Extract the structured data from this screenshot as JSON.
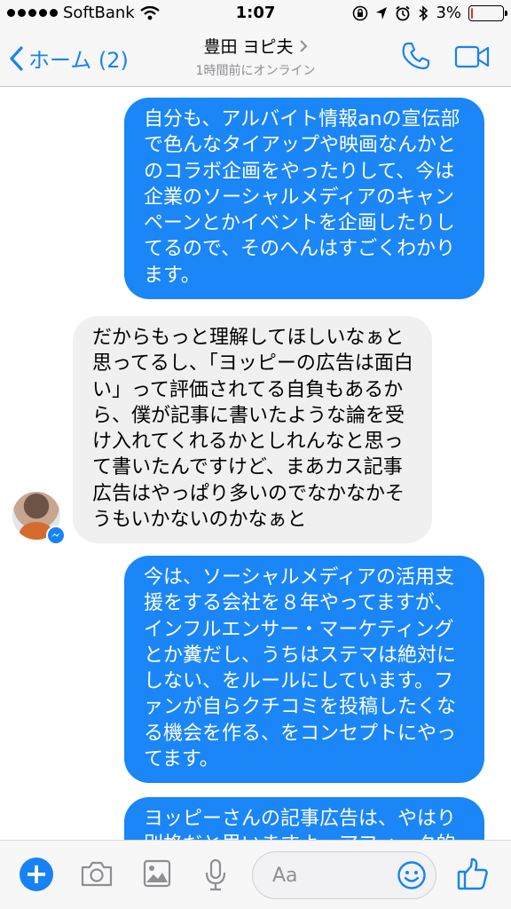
{
  "status_bar": {
    "carrier": "SoftBank",
    "time": "1:07",
    "battery": "3%",
    "battery_level": 0.03,
    "signal_icon": "signal-dots-icon",
    "wifi_icon": "wifi-icon"
  },
  "header": {
    "back_label": "ホーム (2)",
    "contact_name": "豊田 ヨピ夫",
    "contact_status": "1時間前にオンライン",
    "call_icon": "phone-icon",
    "video_icon": "video-camera-icon"
  },
  "messages": [
    {
      "direction": "outgoing",
      "text": "自分も、アルバイト情報anの宣伝部で色んなタイアップや映画なんかとのコラボ企画をやったりして、今は企業のソーシャルメディアのキャンペーンとかイベントを企画したりしてるので、そのへんはすごくわかります。"
    },
    {
      "direction": "incoming",
      "text": "だからもっと理解してほしいなぁと思ってるし、「ヨッピーの広告は面白い」って評価されてる自負もあるから、僕が記事に書いたような論を受け入れてくれるかとしれんなと思って書いたんですけど、まあカス記事広告はやっぱり多いのでなかなかそうもいかないのかなぁと"
    },
    {
      "direction": "outgoing",
      "text": "今は、ソーシャルメディアの活用支援をする会社を８年やってますが、インフルエンサー・マーケティングとか糞だし、うちはステマは絶対にしない、をルールにしています。ファンが自らクチコミを投稿したくなる機会を作る、をコンセプトにやってます。"
    },
    {
      "direction": "outgoing",
      "text": "ヨッピーさんの記事広告は、やはり別格だと思いますよ。アフィーク的"
    }
  ],
  "composer": {
    "placeholder": "Aa"
  },
  "colors": {
    "accent": "#1782f5",
    "outgoing_bubble": "#1a86f7",
    "incoming_bubble": "#f1f0f0",
    "battery_low": "#d9332b"
  }
}
